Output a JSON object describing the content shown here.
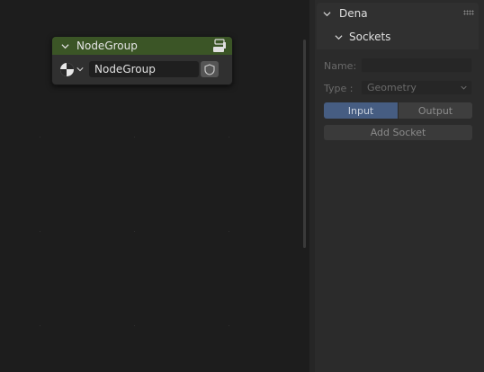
{
  "node": {
    "title": "NodeGroup",
    "datablock_value": "NodeGroup",
    "header_color": "#3b5526",
    "icons": [
      "chevron-down-icon",
      "node-group-icon",
      "sphere-datatype-icon",
      "chevron-down-icon",
      "shield-icon"
    ]
  },
  "sidebar": {
    "panel_title": "Dena",
    "subpanel_title": "Sockets",
    "name_label": "Name:",
    "name_value": "",
    "type_label": "Type :",
    "type_value": "Geometry",
    "input_label": "Input",
    "output_label": "Output",
    "add_socket_label": "Add Socket",
    "active_tab_color": "#465d82"
  }
}
